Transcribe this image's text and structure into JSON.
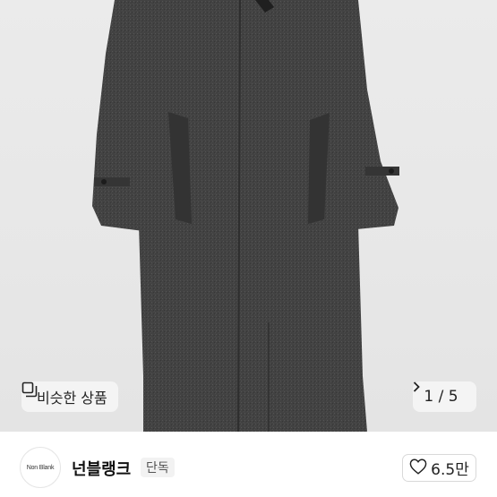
{
  "product": {
    "image_icon": "product-photo-coat",
    "similar_button": {
      "icon": "similar-items-icon",
      "label": "비슷한 상품"
    },
    "pager": {
      "text": "1 / 5",
      "icon": "chevron-right-icon"
    }
  },
  "seller": {
    "avatar_logo": "Non Blank",
    "name": "넌블랭크",
    "badge": "단독"
  },
  "like": {
    "icon": "heart-icon",
    "count": "6.5만"
  },
  "colors": {
    "background": "#ffffff",
    "image_bg": "#e8e8e8",
    "coat": "#3f3f3f"
  }
}
